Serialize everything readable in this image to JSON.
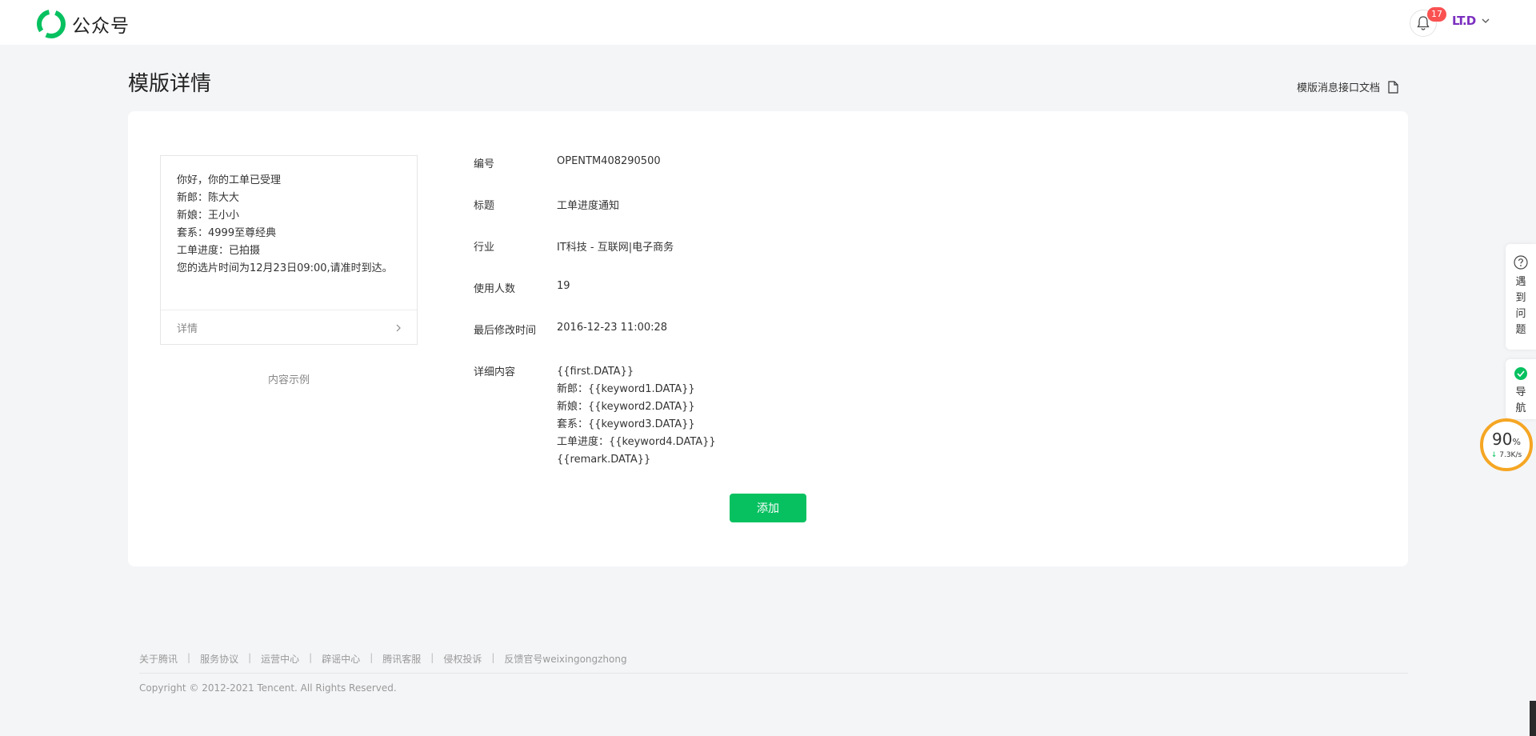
{
  "header": {
    "brand_name": "公众号",
    "notification_count": "17",
    "account_logo_text": "LT.D",
    "brand_color": "#07c160"
  },
  "page": {
    "title": "模版详情",
    "doc_link_label": "模版消息接口文档"
  },
  "preview": {
    "lines": [
      "你好，你的工单已受理",
      "新郎：陈大大",
      "新娘：王小小",
      "套系：4999至尊经典",
      "工单进度：已拍摄",
      "您的选片时间为12月23日09:00,请准时到达。"
    ],
    "details_label": "详情",
    "caption": "内容示例"
  },
  "info": {
    "rows": [
      {
        "label": "编号",
        "value": "OPENTM408290500"
      },
      {
        "label": "标题",
        "value": "工单进度通知"
      },
      {
        "label": "行业",
        "value": "IT科技 - 互联网|电子商务"
      },
      {
        "label": "使用人数",
        "value": "19"
      },
      {
        "label": "最后修改时间",
        "value": "2016-12-23 11:00:28"
      }
    ],
    "content_label": "详细内容",
    "content_lines": [
      "{{first.DATA}}",
      "新郎：{{keyword1.DATA}}",
      "新娘：{{keyword2.DATA}}",
      "套系：{{keyword3.DATA}}",
      "工单进度：{{keyword4.DATA}}",
      "{{remark.DATA}}"
    ]
  },
  "actions": {
    "add_label": "添加"
  },
  "footer": {
    "links": [
      "关于腾讯",
      "服务协议",
      "运营中心",
      "辟谣中心",
      "腾讯客服",
      "侵权投诉",
      "反馈官号weixingongzhong"
    ],
    "copyright": "Copyright © 2012-2021 Tencent. All Rights Reserved."
  },
  "side_widgets": {
    "help_label": "遇到问题",
    "nav_label": "导航",
    "speed_percent": "90",
    "speed_percent_unit": "%",
    "speed_rate": "7.3K/s",
    "speed_ring_color": "#f5a623"
  }
}
